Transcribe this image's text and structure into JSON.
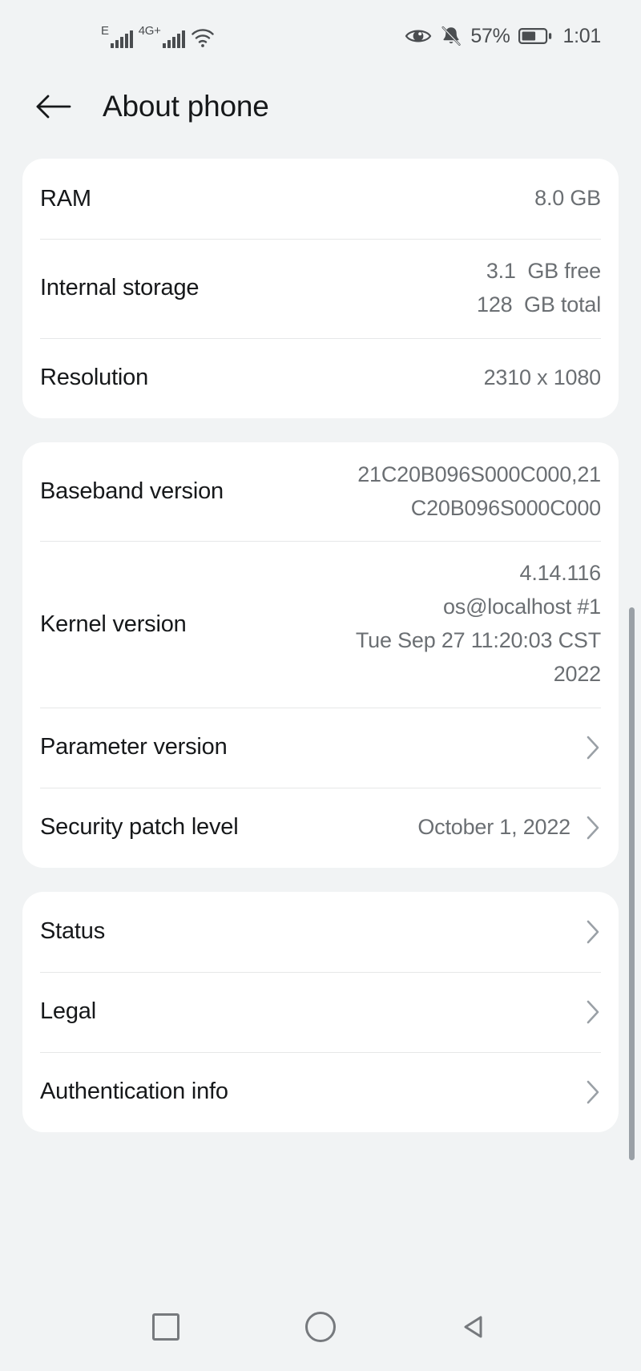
{
  "status_bar": {
    "network_1_label": "E",
    "network_2_label": "4G+",
    "wifi_icon": "wifi-icon",
    "eye_comfort_icon": "eye-icon",
    "silent_icon": "bell-muted-icon",
    "battery_percent": "57%",
    "battery_icon": "battery-icon",
    "time": "1:01"
  },
  "header": {
    "back_icon": "back-arrow-icon",
    "title": "About phone"
  },
  "cards": [
    {
      "rows": [
        {
          "label": "RAM",
          "value": "8.0 GB",
          "type": "value",
          "wrap": false
        },
        {
          "label": "Internal storage",
          "value": "3.1  GB free\n128  GB total",
          "type": "value",
          "wrap": false
        },
        {
          "label": "Resolution",
          "value": "2310 x 1080",
          "type": "value",
          "wrap": false
        }
      ]
    },
    {
      "rows": [
        {
          "label": "Baseband version",
          "value": "21C20B096S000C000,21C20B096S000C000",
          "type": "value",
          "wrap": true
        },
        {
          "label": "Kernel version",
          "value": "4.14.116\nos@localhost #1\nTue Sep 27 11:20:03 CST 2022",
          "type": "value",
          "wrap": true
        },
        {
          "label": "Parameter version",
          "value": "",
          "type": "link",
          "wrap": false
        },
        {
          "label": "Security patch level",
          "value": "October 1, 2022",
          "type": "link-value",
          "wrap": false
        }
      ]
    },
    {
      "rows": [
        {
          "label": "Status",
          "value": "",
          "type": "link",
          "wrap": false
        },
        {
          "label": "Legal",
          "value": "",
          "type": "link",
          "wrap": false
        },
        {
          "label": "Authentication info",
          "value": "",
          "type": "link",
          "wrap": false
        }
      ]
    }
  ],
  "nav_bar": {
    "recents_icon": "square-recents-icon",
    "home_icon": "circle-home-icon",
    "back_icon": "triangle-back-icon"
  },
  "colors": {
    "page_background": "#f1f3f4",
    "card_background": "#ffffff",
    "label_text": "#16181a",
    "value_text": "#6b6f73",
    "divider": "#e6e7e8",
    "icon_gray": "#76797d",
    "scrollbar": "#9aa0a6"
  }
}
